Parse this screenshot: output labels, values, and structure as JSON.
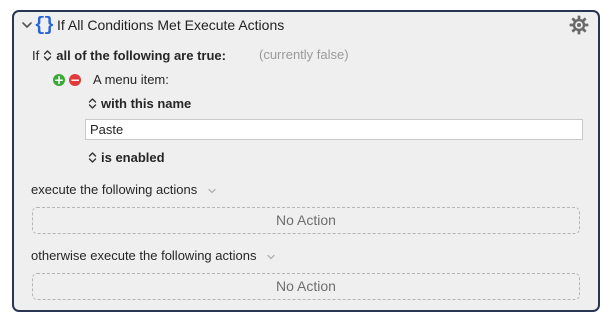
{
  "action": {
    "title": "If All Conditions Met Execute Actions",
    "icon": "braces-icon"
  },
  "condition": {
    "if_label": "If",
    "match_mode": "all of the following are true:",
    "status": "(currently false)",
    "item": {
      "label": "A menu item:",
      "name_mode": "with this name",
      "name_value": "Paste",
      "state": "is enabled"
    }
  },
  "then_block": {
    "label": "execute the following actions",
    "empty_text": "No Action"
  },
  "else_block": {
    "label": "otherwise execute the following actions",
    "empty_text": "No Action"
  },
  "colors": {
    "border": "#2a3553",
    "accent": "#2a63d6",
    "add": "#3da83a",
    "remove": "#e03a3a",
    "panel": "#efefef"
  }
}
